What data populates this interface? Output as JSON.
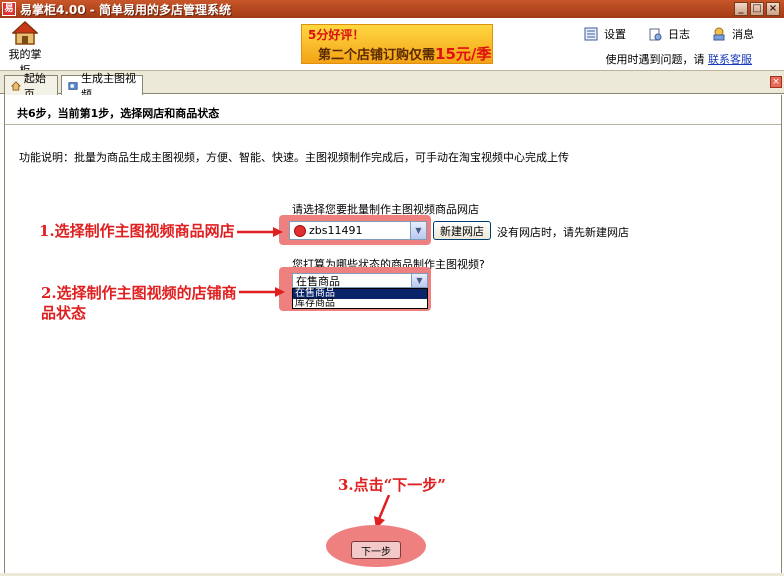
{
  "window": {
    "title": "易掌柜4.00 - 简单易用的多店管理系统",
    "app_icon_text": "易",
    "controls": [
      "_",
      "□",
      "×"
    ]
  },
  "header": {
    "home_label": "我的掌柜",
    "banner": {
      "line1": "5分好评！",
      "line2": "第二个店铺订购仅需",
      "price": "15元/季"
    },
    "tools": [
      {
        "icon": "settings-icon",
        "label": "设置"
      },
      {
        "icon": "log-icon",
        "label": "日志"
      },
      {
        "icon": "message-icon",
        "label": "消息"
      }
    ],
    "help_text": "使用时遇到问题，请",
    "help_link": "联系客服"
  },
  "tabs": [
    {
      "label": "起始页",
      "icon": "home-icon",
      "active": false
    },
    {
      "label": "生成主图视频",
      "icon": "video-icon",
      "active": true
    }
  ],
  "tab_close": "×",
  "content": {
    "step_title": "共6步，当前第1步，选择网店和商品状态",
    "description": "功能说明：批量为商品生成主图视频，方便、智能、快速。主图视频制作完成后，可手动在淘宝视频中心完成上传",
    "shop_label": "请选择您要批量制作主图视频商品网店",
    "shop_selected": "zbs11491",
    "new_shop_button": "新建网店",
    "no_shop_hint": "没有网店时，请先新建网店",
    "status_label": "您打算为哪些状态的商品制作主图视频?",
    "status_selected": "在售商品",
    "status_options": [
      "在售商品",
      "库存商品"
    ],
    "next_button": "下一步"
  },
  "annotations": {
    "a1": "1.选择制作主图视频商品网店",
    "a2": "2.选择制作主图视频的店铺商品状态",
    "a3": "3.点击“下一步”"
  },
  "colors": {
    "title_bar": "#b4461e",
    "highlight": "#ef8080",
    "annotation": "#e02020",
    "link": "#1a3cb8"
  }
}
